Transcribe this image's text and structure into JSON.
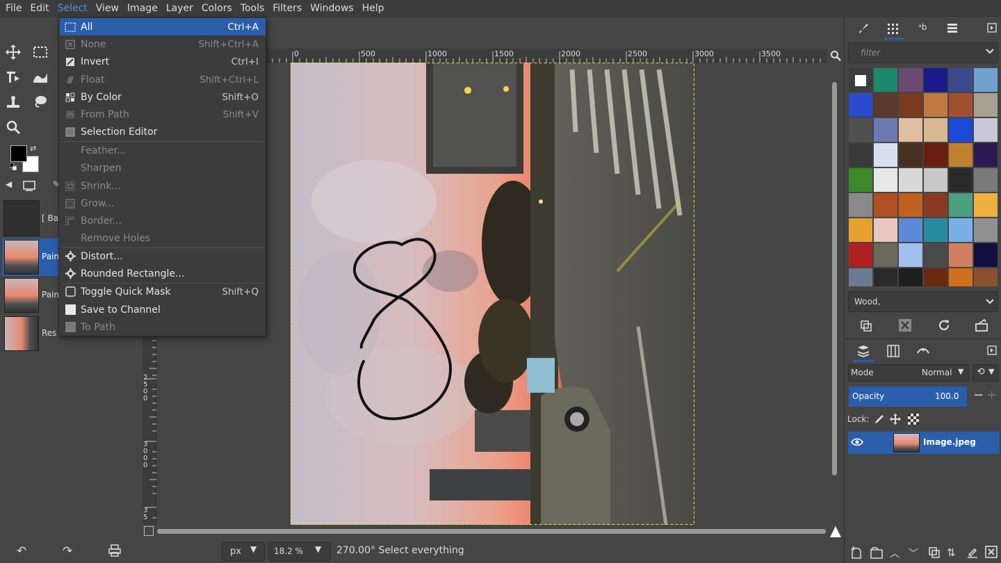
{
  "menubar": {
    "items": [
      "File",
      "Edit",
      "Select",
      "View",
      "Image",
      "Layer",
      "Colors",
      "Tools",
      "Filters",
      "Windows",
      "Help"
    ],
    "active_index": 2
  },
  "select_menu": {
    "items": [
      {
        "label": "All",
        "shortcut": "Ctrl+A",
        "icon": "select-all-icon",
        "enabled": true,
        "highlighted": true
      },
      {
        "label": "None",
        "shortcut": "Shift+Ctrl+A",
        "icon": "select-none-icon",
        "enabled": false
      },
      {
        "label": "Invert",
        "shortcut": "Ctrl+I",
        "icon": "invert-icon",
        "enabled": true
      },
      {
        "label": "Float",
        "shortcut": "Shift+Ctrl+L",
        "icon": "float-icon",
        "enabled": false
      },
      {
        "label": "By Color",
        "shortcut": "Shift+O",
        "icon": "by-color-icon",
        "enabled": true
      },
      {
        "label": "From Path",
        "shortcut": "Shift+V",
        "icon": "from-path-icon",
        "enabled": false
      },
      {
        "label": "Selection Editor",
        "shortcut": "",
        "icon": "selection-editor-icon",
        "enabled": true
      },
      {
        "label": "Feather...",
        "shortcut": "",
        "icon": "",
        "enabled": false
      },
      {
        "label": "Sharpen",
        "shortcut": "",
        "icon": "",
        "enabled": false
      },
      {
        "label": "Shrink...",
        "shortcut": "",
        "icon": "shrink-icon",
        "enabled": false
      },
      {
        "label": "Grow...",
        "shortcut": "",
        "icon": "grow-icon",
        "enabled": false
      },
      {
        "label": "Border...",
        "shortcut": "",
        "icon": "border-icon",
        "enabled": false
      },
      {
        "label": "Remove Holes",
        "shortcut": "",
        "icon": "",
        "enabled": false
      },
      {
        "label": "Distort...",
        "shortcut": "",
        "icon": "gear-icon",
        "enabled": true
      },
      {
        "label": "Rounded Rectangle...",
        "shortcut": "",
        "icon": "gear-icon",
        "enabled": true
      },
      {
        "label": "Toggle Quick Mask",
        "shortcut": "Shift+Q",
        "icon": "quick-mask-icon",
        "enabled": true
      },
      {
        "label": "Save to Channel",
        "shortcut": "",
        "icon": "channel-icon",
        "enabled": true
      },
      {
        "label": "To Path",
        "shortcut": "",
        "icon": "to-path-icon",
        "enabled": false
      }
    ]
  },
  "ruler": {
    "h_labels": [
      "0",
      "500",
      "1000",
      "1500",
      "2000",
      "2500",
      "3000",
      "3500"
    ],
    "v_labels": [
      "2\n5\n0\n0",
      "3\n0\n0\n0",
      "3\n5"
    ]
  },
  "left_dock": {
    "images": [
      {
        "label": "[ Ba"
      },
      {
        "label": "Pain"
      },
      {
        "label": "Pain"
      },
      {
        "label": "Res"
      }
    ]
  },
  "status": {
    "unit": "px",
    "zoom": "18.2 %",
    "message": "270.00° Select everything"
  },
  "patterns_panel": {
    "filter_placeholder": "filter",
    "selected_pattern": "Wood,"
  },
  "layers_panel": {
    "mode_label": "Mode",
    "mode_value": "Normal",
    "opacity_label": "Opacity",
    "opacity_value": "100.0",
    "lock_label": "Lock:",
    "layer_name": "Image.jpeg"
  },
  "colors": {
    "accent": "#2a5eab",
    "menu_bg": "#3c3c3c",
    "selection_outline": "#e8e83a"
  }
}
